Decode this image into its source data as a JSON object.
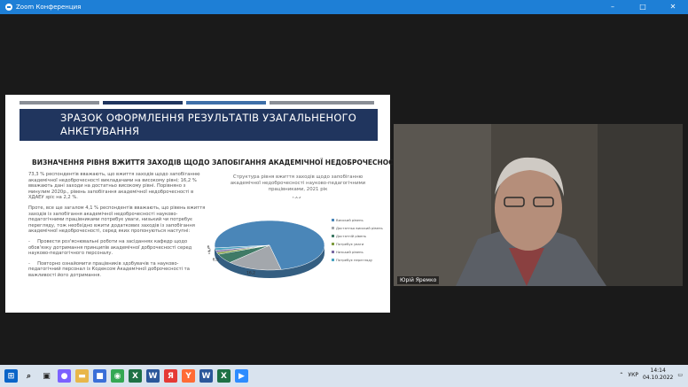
{
  "window": {
    "title": "Zoom Конференция",
    "controls": [
      "–",
      "□",
      "✕"
    ]
  },
  "slide": {
    "banner_title": "ЗРАЗОК ОФОРМЛЕННЯ РЕЗУЛЬТАТІВ УЗАГАЛЬНЕНОГО АНКЕТУВАННЯ",
    "subtitle": "ВИЗНАЧЕННЯ РІВНЯ ВЖИТТЯ ЗАХОДІВ ЩОДО ЗАПОБІГАННЯ АКАДЕМІЧНОЇ НЕДОБРОЧЕСНОСТІ НПП",
    "paragraph1": "73,3 % респондентів вважають, що вжиття заходів щодо запобіганню академічної недоброчесності викладачами на високому рівні; 16,2 % вважають дані заходи на достатньо високому рівні. Порівняно з минулим 2020р., рівень запобігання академічної недоброчесності в ХДАЕУ зріс на 2,2 %.",
    "paragraph2": "Проте, все ще загалом 4,1 % респондентів вважають, що рівень вжиття заходів із запобігання академічної недоброчесності науково-педагогічними працівниками потребує уваги, низький чи потребує перегляду, тож необхідно вжити додаткових заходів із запобігання академічної недоброчесності, серед яких пропонуються наступні:",
    "bullet1": "Провести роз'яснювальні роботи на засіданнях кафедр щодо обов'язку дотримання принципів академічної доброчесності серед науково-педагогічного персоналу.",
    "bullet2": "Повторно ознайомити працівників здобувачів та науково-педагогічний персонал із Кодексом Академічної доброчесності та важливості його дотримання.",
    "bullet_mark": "-"
  },
  "chart_data": {
    "type": "pie",
    "title": "Структура рівня вжиття заходів щодо запобіганню академічної недоброчесності науково-педагогічними працівниками, 2021 рік",
    "categories": [
      "Високий рівень",
      "Достатньо високий рівень",
      "Достатній рівень",
      "Потребує уваги",
      "Низький рівень",
      "Потребує перегляду"
    ],
    "values": [
      73.3,
      16.2,
      6.3,
      1.3,
      1.3,
      1.6
    ],
    "data_labels": [
      "73,3",
      "16,2",
      "6,3",
      "1",
      "1,3",
      "1,6"
    ],
    "colors": [
      "#4a86b8",
      "#a3a7ac",
      "#3f7a66",
      "#7f9b3f",
      "#7a6aa3",
      "#4aa3c0"
    ],
    "legend": "right"
  },
  "video": {
    "participant_name": "Юрій Яремко"
  },
  "taskbar": {
    "apps": [
      {
        "name": "start-icon",
        "color": "#0a64c8",
        "glyph": "⊞"
      },
      {
        "name": "search-icon",
        "color": "#d9e3ee",
        "glyph": "⌕"
      },
      {
        "name": "widgets-icon",
        "color": "#d9e3ee",
        "glyph": "▣"
      },
      {
        "name": "chat-icon",
        "color": "#7b61ff",
        "glyph": "●"
      },
      {
        "name": "explorer-icon",
        "color": "#e8b64a",
        "glyph": "▬"
      },
      {
        "name": "store-icon",
        "color": "#3a6fd8",
        "glyph": "■"
      },
      {
        "name": "chrome-icon",
        "color": "#34a853",
        "glyph": "◉"
      },
      {
        "name": "excel-icon",
        "color": "#1e7145",
        "glyph": "X"
      },
      {
        "name": "word-icon",
        "color": "#2b579a",
        "glyph": "W"
      },
      {
        "name": "yandex-icon",
        "color": "#e53935",
        "glyph": "Я"
      },
      {
        "name": "yandex-browser-icon",
        "color": "#ff6b35",
        "glyph": "Y"
      },
      {
        "name": "word2-icon",
        "color": "#2b579a",
        "glyph": "W"
      },
      {
        "name": "excel2-icon",
        "color": "#1e7145",
        "glyph": "X"
      },
      {
        "name": "zoom-icon",
        "color": "#2d8cff",
        "glyph": "▶"
      }
    ],
    "tray": {
      "language": "УКР",
      "time": "14:14",
      "date": "04.10.2022"
    }
  }
}
